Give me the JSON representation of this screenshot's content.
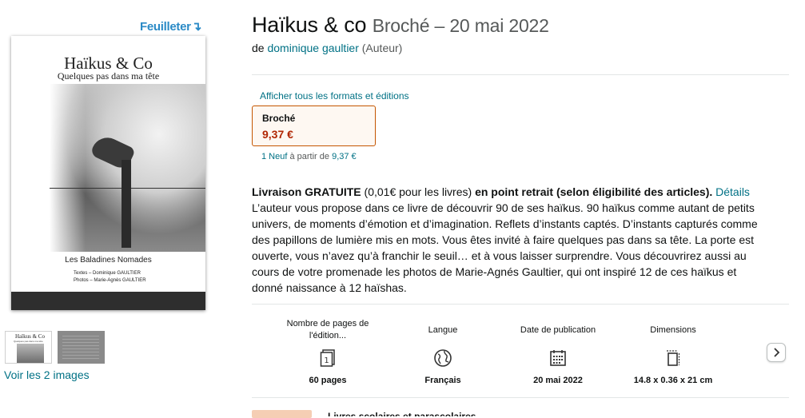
{
  "images": {
    "feuilleter_label": "Feuilleter",
    "cover": {
      "title": "Haïkus & Co",
      "subtitle": "Quelques pas dans ma tête",
      "publisher": "Les Baladines Nomades",
      "credits_line1": "Textes – Dominique GAULTIER",
      "credits_line2": "Photos – Marie-Agnès GAULTIER"
    },
    "thumb1_title": "Haïkus & Co",
    "thumb1_sub": "Quelques pas dans ma tête",
    "voir_label": "Voir les 2 images"
  },
  "product": {
    "title": "Haïkus & co",
    "format_date": "Broché – 20 mai 2022",
    "by": "de",
    "author": "dominique gaultier",
    "author_role": "(Auteur)"
  },
  "formats": {
    "all_formats_link": "Afficher tous les formats et éditions",
    "selected": {
      "name": "Broché",
      "price": "9,37 €"
    },
    "offers_link": "1 Neuf",
    "offers_text": "à partir de",
    "offers_price": "9,37 €"
  },
  "description": {
    "delivery_bold": "Livraison GRATUITE",
    "delivery_text": " (0,01€ pour les livres) ",
    "delivery_bold2": "en point retrait (selon éligibilité des articles).",
    "details_link": "Détails",
    "body": "L’auteur vous propose dans ce livre de découvrir 90 de ses haïkus. 90 haïkus comme autant de petits univers, de moments d’émotion et d’imagination. Reflets d’instants captés. D’instants capturés comme des papillons de lumière mis en mots. Vous êtes invité à faire quelques pas dans sa tête. La porte est ouverte, vous n’avez qu’à franchir le seuil… et à vous laisser surprendre. Vous découvrirez aussi au cours de votre promenade les photos de Marie-Agnés Gaultier, qui ont inspiré 12 de ces haïkus et donné naissance à 12 haïshas."
  },
  "details": [
    {
      "label": "Nombre de pages de l'édition...",
      "icon": "pages-icon",
      "value": "60 pages"
    },
    {
      "label": "Langue",
      "icon": "globe-icon",
      "value": "Français"
    },
    {
      "label": "Date de publication",
      "icon": "calendar-icon",
      "value": "20 mai 2022"
    },
    {
      "label": "Dimensions",
      "icon": "dimensions-icon",
      "value": "14.8 x 0.36 x 21 cm"
    }
  ],
  "bottom": {
    "text": "Livres scolaires et parascolaires"
  },
  "colors": {
    "link": "#007185",
    "price": "#b12704",
    "selected_border": "#c45500",
    "feuilleter": "#2a8ac6"
  }
}
